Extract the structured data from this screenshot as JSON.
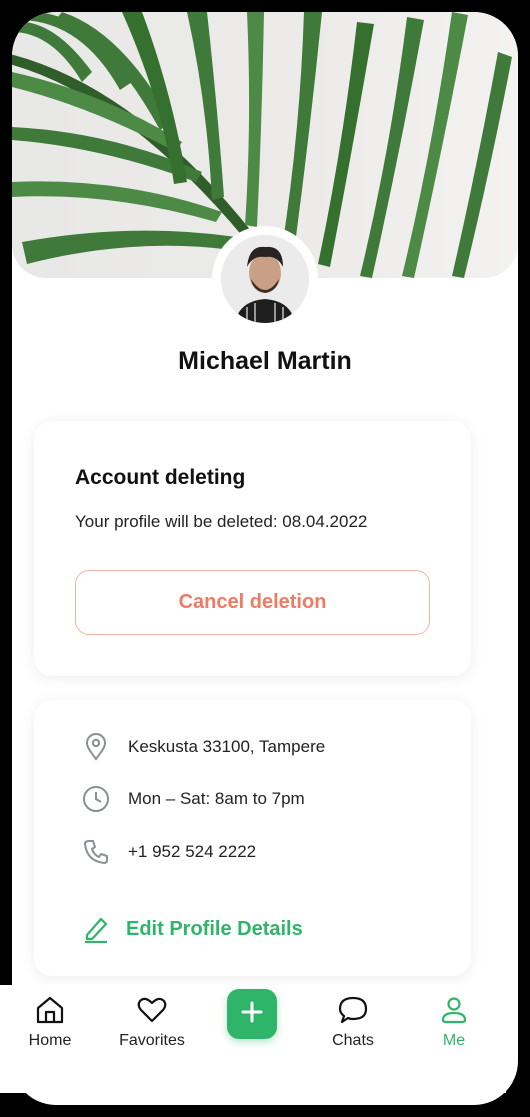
{
  "profile": {
    "name": "Michael Martin"
  },
  "deletion": {
    "title": "Account deleting",
    "message": "Your profile will be deleted: 08.04.2022",
    "cancel_label": "Cancel deletion"
  },
  "details": {
    "address": "Keskusta 33100, Tampere",
    "hours": "Mon – Sat: 8am to 7pm",
    "phone": "+1 952 524 2222",
    "edit_label": "Edit Profile Details"
  },
  "nav": {
    "items": [
      {
        "label": "Home",
        "icon": "home-icon"
      },
      {
        "label": "Favorites",
        "icon": "heart-icon"
      },
      {
        "label": "Chats",
        "icon": "chat-bubble-icon"
      },
      {
        "label": "Me",
        "icon": "person-icon"
      }
    ],
    "add_icon": "plus-icon"
  },
  "colors": {
    "accent_green": "#2fb56a",
    "cancel_coral": "#ec7c63",
    "cancel_border": "#f0b5a6"
  }
}
